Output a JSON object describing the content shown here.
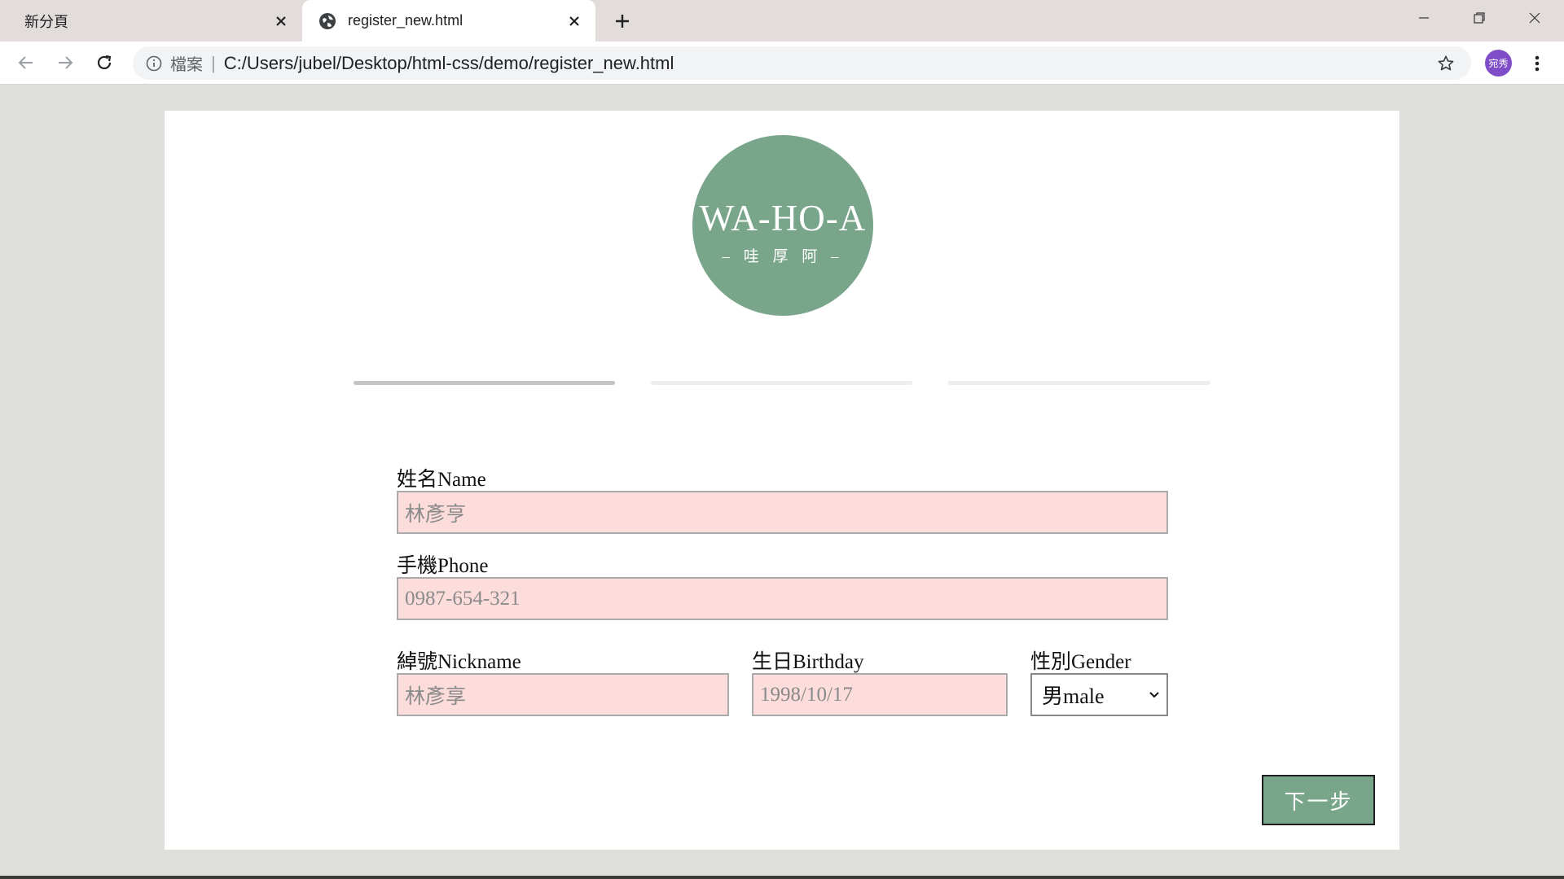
{
  "browser": {
    "tabs": [
      {
        "label": "新分頁",
        "active": false
      },
      {
        "label": "register_new.html",
        "active": true
      }
    ],
    "omnibox": {
      "scheme_label": "檔案",
      "separator": "|",
      "url": "C:/Users/jubel/Desktop/html-css/demo/register_new.html"
    },
    "profile_avatar": "宛秀",
    "icons": [
      "back-icon",
      "forward-icon",
      "reload-icon",
      "info-icon",
      "star-icon",
      "kebab-menu-icon",
      "globe-icon",
      "close-icon",
      "plus-icon",
      "minimize-icon",
      "restore-icon"
    ]
  },
  "page": {
    "logo": {
      "title": "WA-HO-A",
      "subtitle": "– 哇 厚 阿 –",
      "color": "#79a68b"
    },
    "steps": {
      "total": 3,
      "current": 1
    },
    "form": {
      "name": {
        "label": "姓名Name",
        "placeholder": "林彥亨"
      },
      "phone": {
        "label": "手機Phone",
        "placeholder": "0987-654-321"
      },
      "nickname": {
        "label": "綽號Nickname",
        "placeholder": "林彥享"
      },
      "birthday": {
        "label": "生日Birthday",
        "placeholder": "1998/10/17"
      },
      "gender": {
        "label": "性別Gender",
        "selected": "男male"
      }
    },
    "next_button": "下一步",
    "colors": {
      "field_bg": "#fddcdc",
      "page_bg": "#dededa",
      "accent": "#79a68b"
    }
  }
}
